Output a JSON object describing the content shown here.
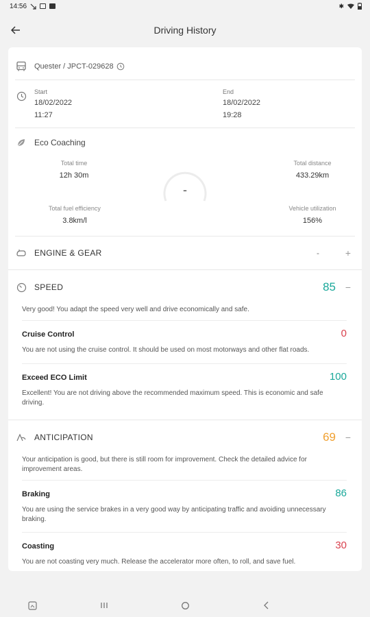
{
  "status_bar": {
    "time": "14:56"
  },
  "app_bar": {
    "title": "Driving History"
  },
  "vehicle": {
    "label": "Quester / JPCT-029628"
  },
  "trip": {
    "start_label": "Start",
    "start_date": "18/02/2022",
    "start_time": "11:27",
    "end_label": "End",
    "end_date": "18/02/2022",
    "end_time": "19:28"
  },
  "eco": {
    "title": "Eco Coaching",
    "total_time_label": "Total time",
    "total_time": "12h 30m",
    "total_distance_label": "Total distance",
    "total_distance": "433.29km",
    "fuel_eff_label": "Total fuel efficiency",
    "fuel_eff": "3.8km/l",
    "utilization_label": "Vehicle utilization",
    "utilization": "156%",
    "score": "-"
  },
  "engine": {
    "title": "ENGINE & GEAR",
    "dash": "-",
    "expand": "+"
  },
  "speed": {
    "title": "SPEED",
    "score": "85",
    "collapse": "−",
    "desc": "Very good! You adapt the speed very well and drive economically and safe.",
    "items": [
      {
        "title": "Cruise Control",
        "score": "0",
        "desc": "You are not using the cruise control. It should be used on most motorways and other flat roads."
      },
      {
        "title": "Exceed ECO Limit",
        "score": "100",
        "desc": "Excellent! You are not driving above the recommended maximum speed. This is economic and safe driving."
      }
    ]
  },
  "anticipation": {
    "title": "ANTICIPATION",
    "score": "69",
    "collapse": "−",
    "desc": "Your anticipation is good, but there is still room for improvement. Check the detailed advice for improvement areas.",
    "items": [
      {
        "title": "Braking",
        "score": "86",
        "desc": "You are using the service brakes in a very good way by anticipating traffic and avoiding unnecessary braking."
      },
      {
        "title": "Coasting",
        "score": "30",
        "desc": "You are not coasting very much. Release the accelerator more often, to roll, and save fuel."
      }
    ]
  },
  "colors": {
    "good": "#1aa89a",
    "warn": "#f0a030",
    "bad": "#d9414e"
  }
}
